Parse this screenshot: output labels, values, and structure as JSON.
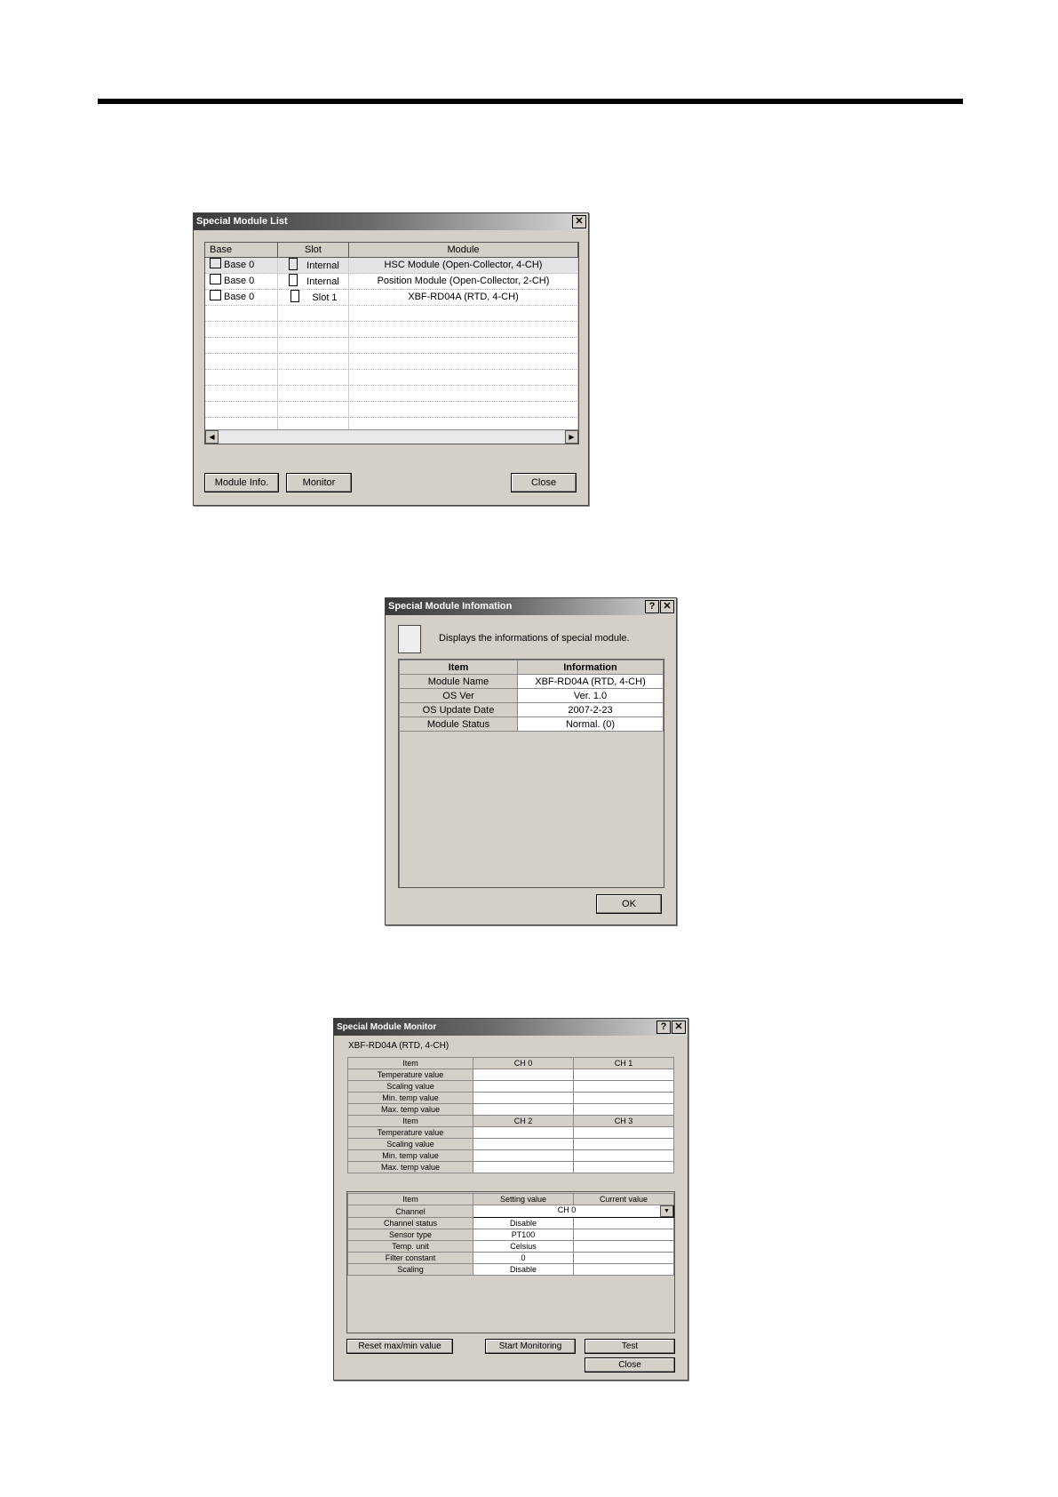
{
  "list_window": {
    "title": "Special Module List",
    "headers": [
      "Base",
      "Slot",
      "Module"
    ],
    "rows": [
      {
        "base": "Base 0",
        "slot": "Internal",
        "module": "HSC Module (Open-Collector, 4-CH)"
      },
      {
        "base": "Base 0",
        "slot": "Internal",
        "module": "Position Module (Open-Collector, 2-CH)"
      },
      {
        "base": "Base 0",
        "slot": "Slot 1",
        "module": "XBF-RD04A (RTD, 4-CH)"
      }
    ],
    "buttons": {
      "module_info": "Module Info.",
      "monitor": "Monitor",
      "close": "Close"
    }
  },
  "info_window": {
    "title": "Special Module Infomation",
    "description": "Displays the informations of special module.",
    "headers": [
      "Item",
      "Information"
    ],
    "rows": [
      {
        "item": "Module Name",
        "info": "XBF-RD04A (RTD, 4-CH)"
      },
      {
        "item": "OS Ver",
        "info": "Ver.  1.0"
      },
      {
        "item": "OS Update Date",
        "info": "2007-2-23"
      },
      {
        "item": "Module Status",
        "info": "Normal. (0)"
      }
    ],
    "ok": "OK"
  },
  "monitor_window": {
    "title": "Special Module Monitor",
    "module_name": "XBF-RD04A (RTD, 4-CH)",
    "header1": [
      "Item",
      "CH 0",
      "CH 1"
    ],
    "header2": [
      "Item",
      "CH 2",
      "CH 3"
    ],
    "items": [
      "Temperature value",
      "Scaling value",
      "Min. temp value",
      "Max. temp value"
    ],
    "settings_header": [
      "Item",
      "Setting value",
      "Current value"
    ],
    "settings": [
      {
        "item": "Channel",
        "value": "CH 0"
      },
      {
        "item": "Channel status",
        "value": "Disable"
      },
      {
        "item": "Sensor type",
        "value": "PT100"
      },
      {
        "item": "Temp. unit",
        "value": "Celsius"
      },
      {
        "item": "Filter constant",
        "value": "0"
      },
      {
        "item": "Scaling",
        "value": "Disable"
      }
    ],
    "buttons": {
      "reset": "Reset max/min value",
      "start": "Start Monitoring",
      "test": "Test",
      "close": "Close"
    }
  }
}
